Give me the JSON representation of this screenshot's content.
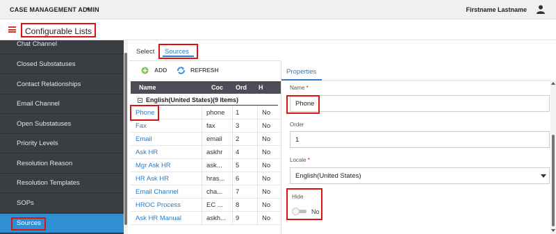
{
  "topbar": {
    "app_name": "CASE MANAGEMENT ADMIN",
    "user_name": "Firstname Lastname"
  },
  "header": {
    "title": "Configurable Lists"
  },
  "sidebar": {
    "items": [
      {
        "label": "Chat Channel"
      },
      {
        "label": "Closed Substatuses"
      },
      {
        "label": "Contact Relationships"
      },
      {
        "label": "Email Channel"
      },
      {
        "label": "Open Substatuses"
      },
      {
        "label": "Priority Levels"
      },
      {
        "label": "Resolution Reason"
      },
      {
        "label": "Resolution Templates"
      },
      {
        "label": "SOPs"
      },
      {
        "label": "Sources"
      }
    ],
    "active": "Sources"
  },
  "tabs": {
    "select_label": "Select",
    "sources_label": "Sources"
  },
  "toolbar": {
    "add_label": "ADD",
    "refresh_label": "REFRESH"
  },
  "grid": {
    "columns": [
      "Name",
      "Coc",
      "Ord",
      "H"
    ],
    "group_label": "English(United States)(9 Items)",
    "rows": [
      {
        "name": "Phone",
        "code": "phone",
        "order": "1",
        "hide": "No"
      },
      {
        "name": "Fax",
        "code": "fax",
        "order": "3",
        "hide": "No"
      },
      {
        "name": "Email",
        "code": "email",
        "order": "2",
        "hide": "No"
      },
      {
        "name": "Ask HR",
        "code": "askhr",
        "order": "4",
        "hide": "No"
      },
      {
        "name": "Mgr Ask HR",
        "code": "ask...",
        "order": "5",
        "hide": "No"
      },
      {
        "name": "HR Ask HR",
        "code": "hras...",
        "order": "6",
        "hide": "No"
      },
      {
        "name": "Email Channel",
        "code": "cha...",
        "order": "7",
        "hide": "No"
      },
      {
        "name": "HROC Process",
        "code": "EC ...",
        "order": "8",
        "hide": "No"
      },
      {
        "name": "Ask HR Manual",
        "code": "askh...",
        "order": "9",
        "hide": "No"
      }
    ]
  },
  "properties": {
    "tab_label": "Properties",
    "name_label": "Name",
    "name_required": "*",
    "name_value": "Phone",
    "order_label": "Order",
    "order_value": "1",
    "locale_label": "Locale",
    "locale_required": "*",
    "locale_value": "English(United States)",
    "hide_label": "Hide",
    "hide_value": "No"
  },
  "colors": {
    "accent": "#2c7bc4",
    "sidebar_bg": "#3a3d42",
    "active_item": "#2f8fd0",
    "highlight_border": "#dd1111"
  }
}
